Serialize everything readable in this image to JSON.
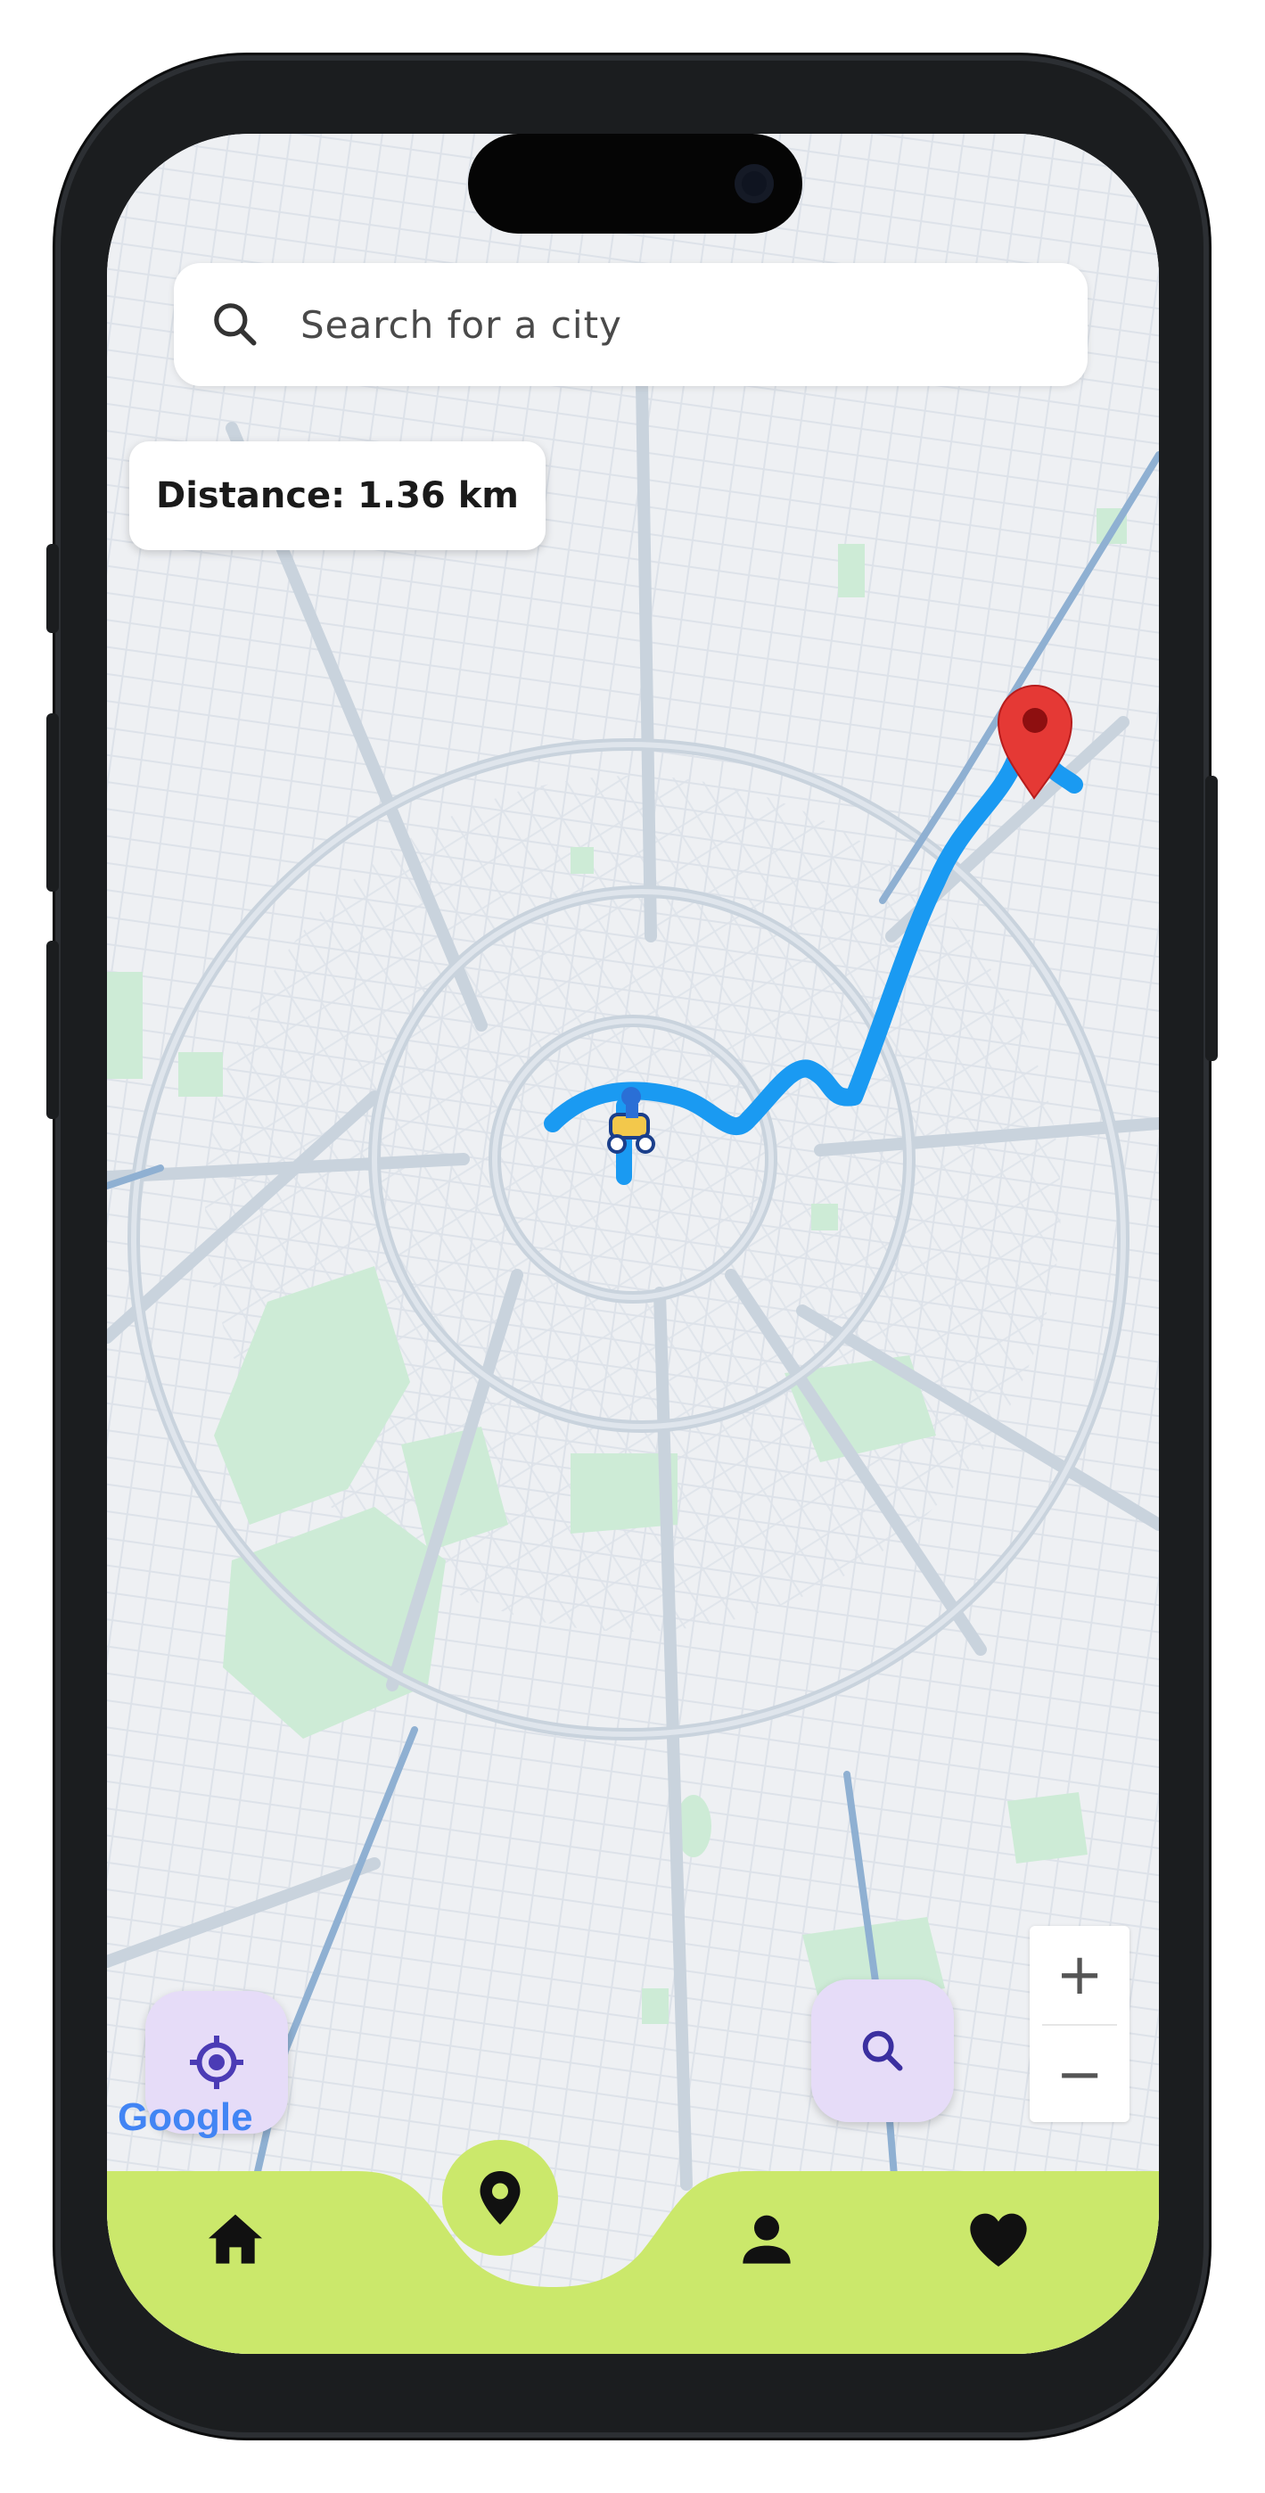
{
  "search": {
    "placeholder": "Search for a city",
    "value": ""
  },
  "distance": {
    "label": "Distance: 1.36 km"
  },
  "attribution": {
    "text": "Google"
  },
  "zoom": {
    "in_label": "+",
    "out_label": "−"
  },
  "fabs": {
    "locate_icon": "target-icon",
    "search_icon": "search-icon"
  },
  "bottom_nav": {
    "items": [
      {
        "name": "home",
        "icon": "home-icon"
      },
      {
        "name": "location",
        "icon": "location-pin-icon",
        "active": true
      },
      {
        "name": "profile",
        "icon": "person-icon"
      },
      {
        "name": "favorites",
        "icon": "heart-icon"
      }
    ]
  },
  "colors": {
    "route": "#1a9af2",
    "nav_bar": "#cbe86b",
    "fab_bg": "#e6dcf8",
    "fab_icon": "#4b3bb5",
    "marker": "#e53935"
  }
}
